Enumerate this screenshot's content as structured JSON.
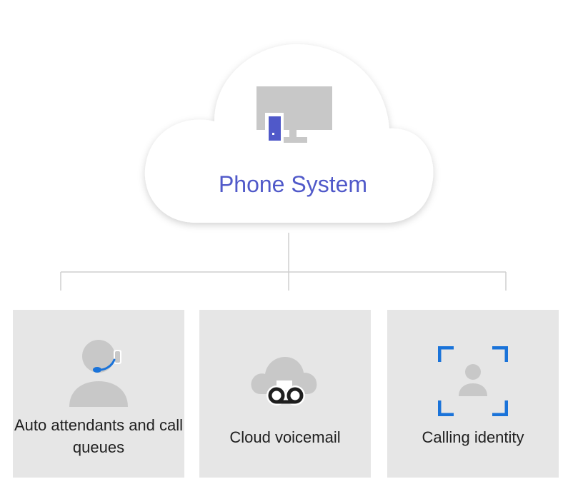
{
  "cloud": {
    "title": "Phone System",
    "icon": "desktop-phone-icon"
  },
  "cards": [
    {
      "label": "Auto attendants and call queues",
      "icon": "headset-agent-icon"
    },
    {
      "label": "Cloud voicemail",
      "icon": "cloud-voicemail-icon"
    },
    {
      "label": "Calling identity",
      "icon": "calling-identity-icon"
    }
  ],
  "colors": {
    "accent": "#5059c9",
    "blue": "#1a73d9",
    "icon_gray": "#c8c8c8",
    "card_bg": "#e6e6e6",
    "connector": "#cfcfcf",
    "dark": "#1f1f1f"
  }
}
